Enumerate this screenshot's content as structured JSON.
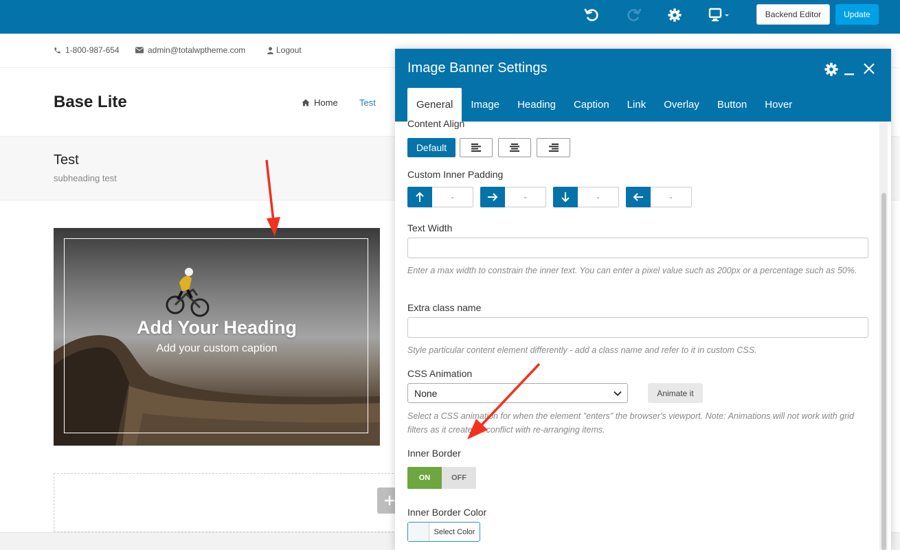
{
  "toolbar": {
    "icons": [
      "undo-icon",
      "redo-icon",
      "gear-icon",
      "monitor-icon"
    ],
    "backend_editor_label": "Backend Editor",
    "update_label": "Update"
  },
  "contact": {
    "phone": "1-800-987-654",
    "email": "admin@totalwptheme.com",
    "logout": "Logout"
  },
  "header": {
    "logo": "Base Lite",
    "nav": {
      "home": "Home",
      "test": "Test"
    }
  },
  "page": {
    "title": "Test",
    "subheading": "subheading test"
  },
  "banner": {
    "heading": "Add Your Heading",
    "caption": "Add your custom caption"
  },
  "panel": {
    "title": "Image Banner Settings",
    "tabs": [
      "General",
      "Image",
      "Heading",
      "Caption",
      "Link",
      "Overlay",
      "Button",
      "Hover"
    ],
    "active_tab": "General",
    "content_align": {
      "label": "Content Align",
      "default_label": "Default"
    },
    "inner_padding": {
      "label": "Custom Inner Padding",
      "placeholders": [
        "-",
        "-",
        "-",
        "-"
      ]
    },
    "text_width": {
      "label": "Text Width",
      "help": "Enter a max width to constrain the inner text. You can enter a pixel value such as 200px or a percentage such as 50%."
    },
    "extra_class": {
      "label": "Extra class name",
      "help": "Style particular content element differently - add a class name and refer to it in custom CSS."
    },
    "css_animation": {
      "label": "CSS Animation",
      "selected": "None",
      "animate_button": "Animate it",
      "help": "Select a CSS animation for when the element \"enters\" the browser's viewport. Note: Animations will not work with grid filters as it creates a conflict with re-arranging items."
    },
    "inner_border": {
      "label": "Inner Border",
      "on_label": "ON",
      "off_label": "OFF",
      "value": "ON"
    },
    "inner_border_color": {
      "label": "Inner Border Color",
      "button_label": "Select Color"
    }
  },
  "colors": {
    "primary": "#0473aa",
    "update_button": "#00a0e6",
    "toggle_on": "#6ea63f",
    "annotation_arrow": "#f0321e"
  }
}
